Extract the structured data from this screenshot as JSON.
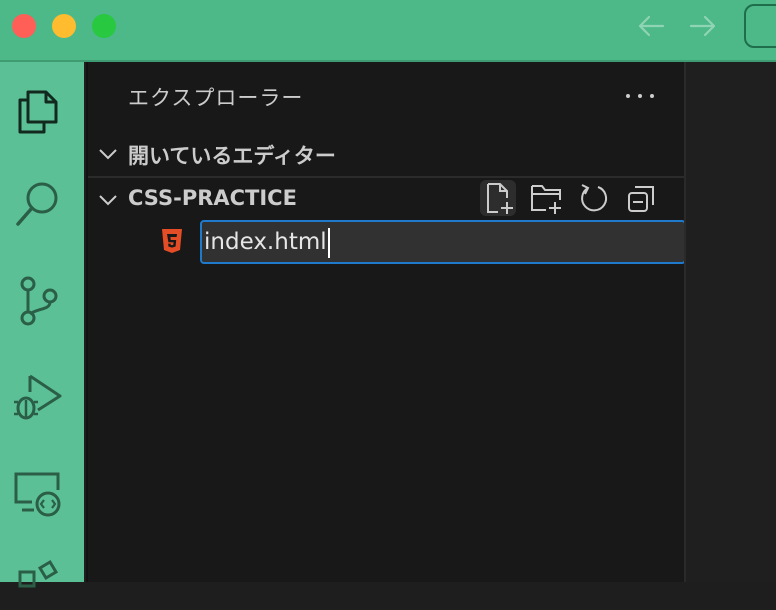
{
  "sidebar": {
    "title": "エクスプローラー",
    "sections": {
      "open_editors": "開いているエディター",
      "project": "CSS-PRACTICE"
    }
  },
  "rename": {
    "value": "index.html"
  },
  "colors": {
    "titlebar": "#4db888",
    "activitybar": "#5cc096",
    "sidebar": "#181818",
    "focus_border": "#1f7acc",
    "html_icon": "#e44d26"
  },
  "icons": {
    "activity": [
      "files-icon",
      "search-icon",
      "source-control-icon",
      "run-debug-icon",
      "remote-explorer-icon",
      "extensions-icon"
    ],
    "toolbar": [
      "new-file-icon",
      "new-folder-icon",
      "refresh-icon",
      "collapse-all-icon"
    ]
  }
}
